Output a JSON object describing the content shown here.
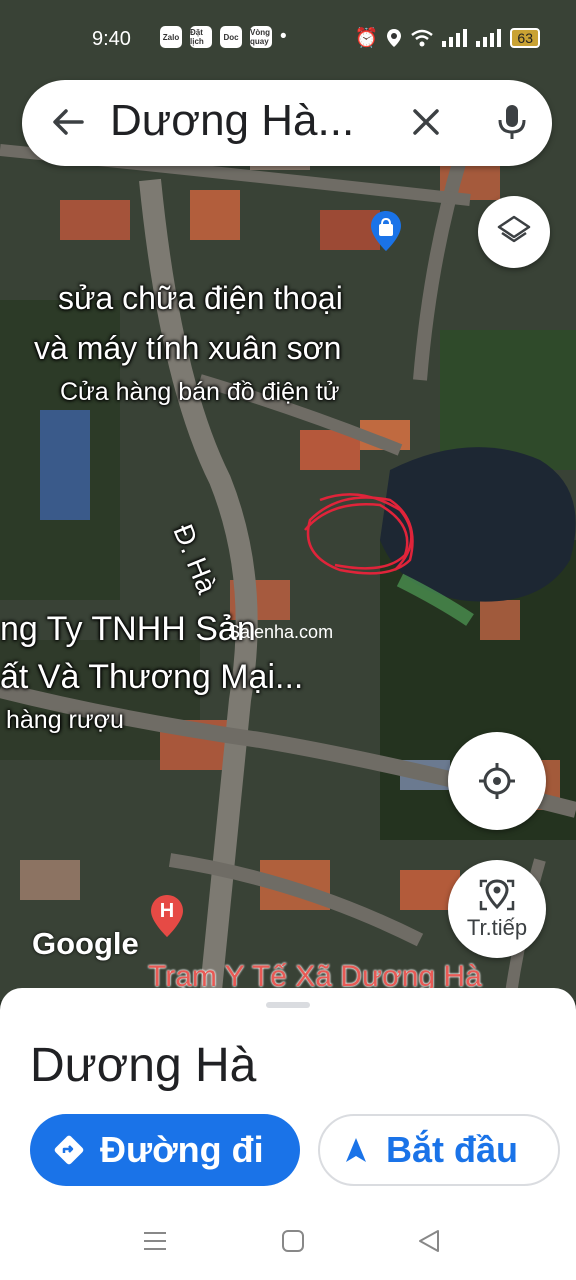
{
  "status_bar": {
    "time": "9:40",
    "app_icons": [
      "Zalo",
      "Đặt lịch",
      "Doc",
      "Vòng quay"
    ],
    "battery": "63"
  },
  "search": {
    "query": "Dương Hà..."
  },
  "map": {
    "poi_name_line1": "sửa chữa điện thoại",
    "poi_name_line2": "và máy tính xuân sơn",
    "poi_category": "Cửa hàng bán đồ điện tử",
    "road_label": "Đ. Hà",
    "company_line1": "ng Ty TNHH Sản",
    "company_line2": "ất Và Thương Mại...",
    "company_category": "hàng rượu",
    "watermark": "Salenha.com",
    "google_logo": "Google",
    "health_station": "Trạm Y Tế Xã Dương Hà",
    "hospital_marker": "H"
  },
  "fab": {
    "directions_label": "Tr.tiếp"
  },
  "sheet": {
    "place_title": "Dương Hà",
    "directions_button": "Đường đi",
    "start_button": "Bắt đầu"
  },
  "colors": {
    "accent": "#1a73e8",
    "annotation": "#e0243a"
  }
}
